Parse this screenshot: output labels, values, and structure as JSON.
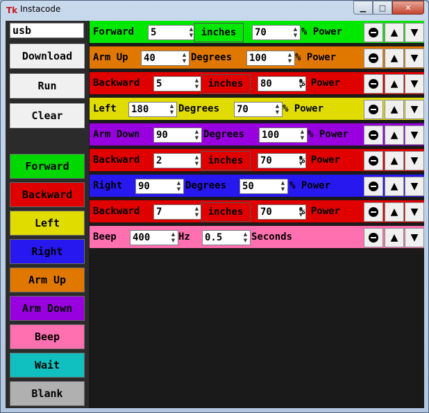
{
  "window": {
    "title": "Instacode",
    "icon_glyph": "Tk",
    "controls": {
      "minimize": "▁",
      "maximize": "□",
      "close": "✕"
    }
  },
  "sidebar": {
    "port_value": "usb",
    "actions": [
      {
        "label": "Download"
      },
      {
        "label": "Run"
      },
      {
        "label": "Clear"
      }
    ],
    "blocks": [
      {
        "label": "Forward",
        "color": "#00d800"
      },
      {
        "label": "Backward",
        "color": "#e00000"
      },
      {
        "label": "Left",
        "color": "#e0dc00"
      },
      {
        "label": "Right",
        "color": "#2818f0"
      },
      {
        "label": "Arm Up",
        "color": "#e07800"
      },
      {
        "label": "Arm Down",
        "color": "#9800e0"
      },
      {
        "label": "Beep",
        "color": "#ff70b0"
      },
      {
        "label": "Wait",
        "color": "#10c0c0"
      },
      {
        "label": "Blank",
        "color": "#b0b0b0"
      }
    ]
  },
  "program": [
    {
      "cmd": "Forward",
      "color": "#00e800",
      "value1": "5",
      "unit": "inches",
      "value2": "70",
      "suffix": "% Power"
    },
    {
      "cmd": "Arm Up",
      "color": "#e07800",
      "value1": "40",
      "unit_text": "Degrees",
      "value2": "100",
      "suffix": "% Power"
    },
    {
      "cmd": "Backward",
      "color": "#e00000",
      "value1": "5",
      "unit": "inches",
      "value2": "80",
      "suffix": "% Power"
    },
    {
      "cmd": "Left",
      "color": "#e0dc00",
      "value1": "180",
      "unit_text": "Degrees",
      "value2": "70",
      "suffix": "% Power"
    },
    {
      "cmd": "Arm Down",
      "color": "#9800e0",
      "value1": "90",
      "unit_text": "Degrees",
      "value2": "100",
      "suffix": "% Power"
    },
    {
      "cmd": "Backward",
      "color": "#e00000",
      "value1": "2",
      "unit": "inches",
      "value2": "70",
      "suffix": "% Power"
    },
    {
      "cmd": "Right",
      "color": "#2818f0",
      "value1": "90",
      "unit_text": "Degrees",
      "value2": "50",
      "suffix": "% Power"
    },
    {
      "cmd": "Backward",
      "color": "#e00000",
      "value1": "7",
      "unit": "inches",
      "value2": "70",
      "suffix": "% Power"
    },
    {
      "cmd": "Beep",
      "color": "#ff70b0",
      "value1": "400",
      "unit_text": "Hz",
      "value2": "0.5",
      "suffix": "Seconds"
    }
  ],
  "row_controls": {
    "delete_icon": "remove-icon",
    "up_glyph": "▲",
    "down_glyph": "▼"
  }
}
